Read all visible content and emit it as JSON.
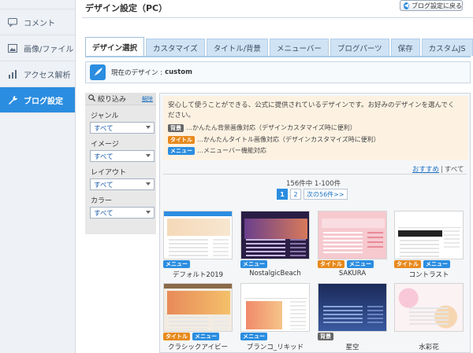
{
  "sidebar": {
    "items": [
      {
        "label": "コメント",
        "icon": "comment-icon"
      },
      {
        "label": "画像/ファイル",
        "icon": "image-icon"
      },
      {
        "label": "アクセス解析",
        "icon": "chart-icon"
      },
      {
        "label": "ブログ設定",
        "icon": "wrench-icon",
        "active": true
      }
    ]
  },
  "header": {
    "title": "デザイン設定（PC）",
    "back_label": "ブログ設定に戻る"
  },
  "tabs": [
    {
      "label": "デザイン選択",
      "active": true
    },
    {
      "label": "カスタマイズ"
    },
    {
      "label": "タイトル/背景"
    },
    {
      "label": "メニューバー"
    },
    {
      "label": "ブログパーツ"
    },
    {
      "label": "保存"
    },
    {
      "label": "カスタムJS"
    }
  ],
  "current": {
    "label": "現在のデザイン :",
    "value": "custom"
  },
  "filter": {
    "title": "絞り込み",
    "reset": "解除",
    "groups": [
      {
        "label": "ジャンル",
        "value": "すべて"
      },
      {
        "label": "イメージ",
        "value": "すべて"
      },
      {
        "label": "レイアウト",
        "value": "すべて"
      },
      {
        "label": "カラー",
        "value": "すべて"
      }
    ]
  },
  "notice": {
    "text": "安心して使うことができる、公式に提供されているデザインです。お好みのデザインを選んでください。",
    "tags": [
      {
        "badge": "背景",
        "text": "…かんたん背景画像対応（デザインカスタマイズ時に便利）"
      },
      {
        "badge": "タイトル",
        "text": "…かんたんタイトル画像対応（デザインカスタマイズ時に便利）"
      },
      {
        "badge": "メニュー",
        "text": "…メニューバー機能対応"
      }
    ]
  },
  "sort": {
    "recommended": "おすすめ",
    "separator": "|",
    "all": "すべて"
  },
  "listing": {
    "count": "156件中 1-100件",
    "pages": [
      "1",
      "2"
    ],
    "next": "次の56件>>"
  },
  "themes": [
    {
      "name": "デフォルト2019",
      "badges": [
        "メニュー"
      ]
    },
    {
      "name": "NostalgicBeach",
      "badges": [
        "メニュー"
      ]
    },
    {
      "name": "SAKURA",
      "badges": [
        "タイトル",
        "メニュー"
      ]
    },
    {
      "name": "コントラスト",
      "badges": [
        "タイトル",
        "メニュー"
      ]
    },
    {
      "name": "クラシックアイビー",
      "badges": [
        "タイトル",
        "メニュー"
      ]
    },
    {
      "name": "ブランコ_リキッド",
      "badges": [
        "メニュー"
      ]
    },
    {
      "name": "星空",
      "badges": [
        "背景"
      ]
    },
    {
      "name": "水彩花",
      "badges": []
    }
  ],
  "colors": {
    "accent": "#2b8de0",
    "badge_menu": "#2b8de0",
    "badge_title": "#e8891c",
    "badge_bg": "#666666",
    "notice_bg": "#fdf2e2"
  }
}
